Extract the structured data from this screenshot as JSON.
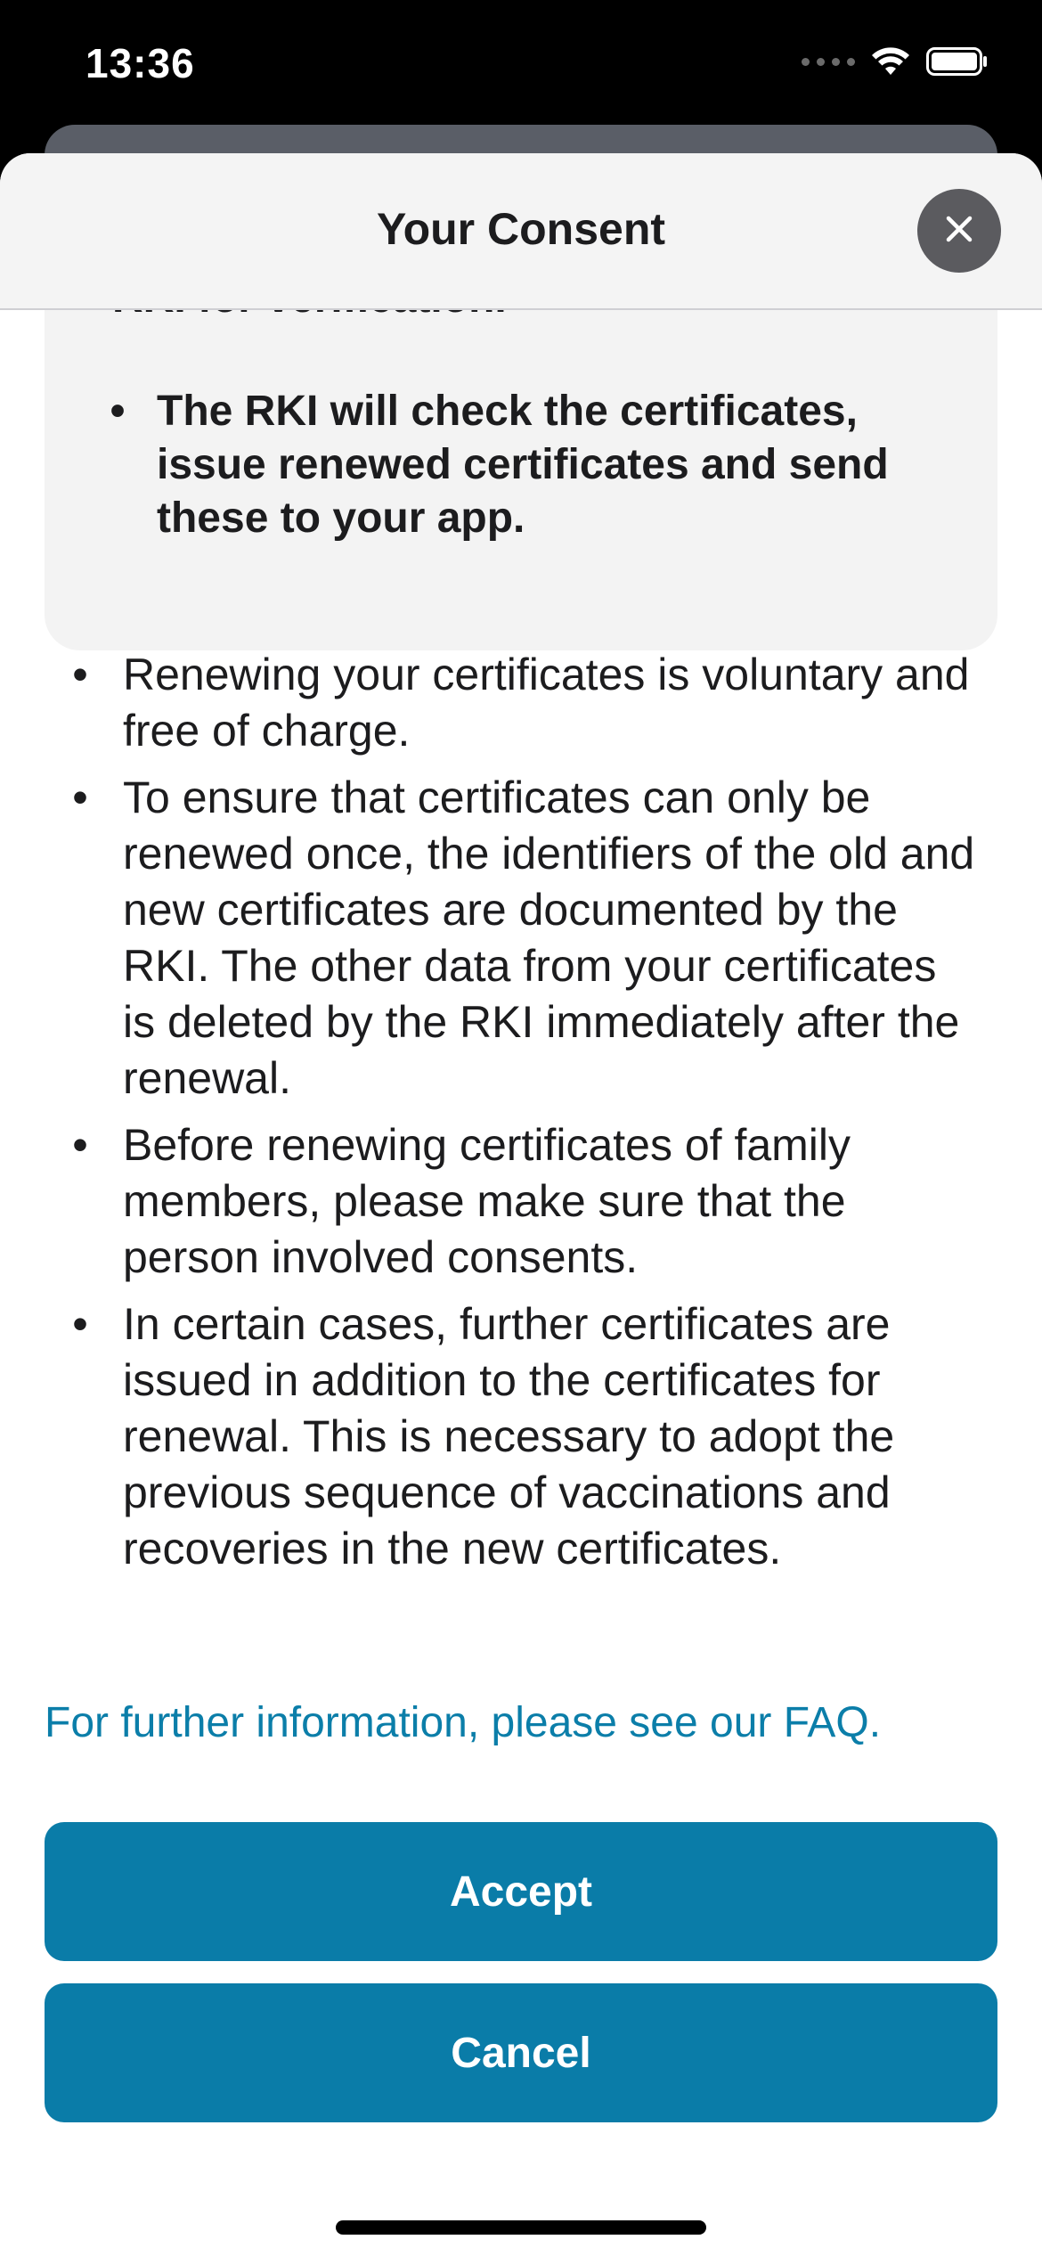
{
  "status_bar": {
    "time": "13:36"
  },
  "header": {
    "title": "Your Consent"
  },
  "info_box": {
    "partial_text": "RKI for verification.",
    "items": [
      "The RKI will check the certificates, issue renewed certificates and send these to your app."
    ]
  },
  "body": {
    "items": [
      "Renewing your certificates is voluntary and free of charge.",
      "To ensure that certificates can only be renewed once, the identifiers of the old and new certificates are documented by the RKI. The other data from your certificates is deleted by the RKI immediately after the renewal.",
      "Before renewing certificates of family members, please make sure that the person involved consents.",
      "In certain cases, further certificates are issued in addition to the certificates for renewal. This is necessary to adopt the previous sequence of vaccinations and recoveries in the new certificates."
    ],
    "faq_link": "For further information, please see our FAQ."
  },
  "actions": {
    "accept": "Accept",
    "cancel": "Cancel"
  },
  "colors": {
    "accent": "#0a7ca8",
    "link": "#0b7ea9"
  },
  "icons": {
    "close": "close-icon",
    "wifi": "wifi-icon",
    "battery": "battery-icon"
  }
}
